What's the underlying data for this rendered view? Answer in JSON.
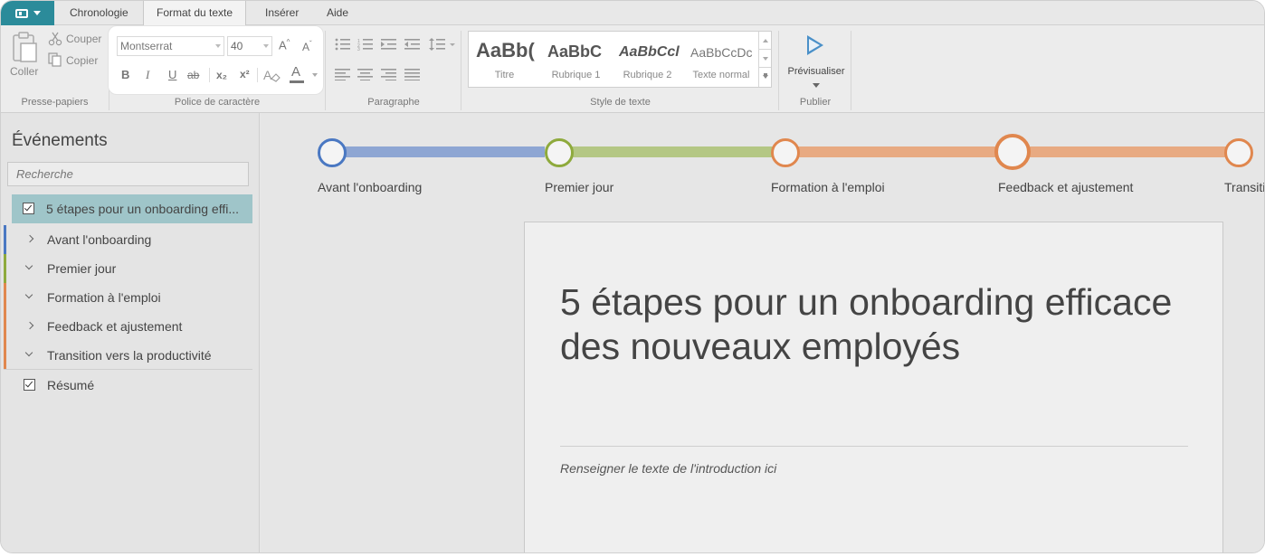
{
  "menu": {
    "tabs": [
      {
        "label": "Chronologie"
      },
      {
        "label": "Format du texte"
      },
      {
        "label": "Insérer"
      },
      {
        "label": "Aide"
      }
    ],
    "active_tab": "Format du texte"
  },
  "ribbon": {
    "clipboard": {
      "paste_label": "Coller",
      "cut_label": "Couper",
      "copy_label": "Copier",
      "group_label": "Presse-papiers"
    },
    "font": {
      "font_name": "Montserrat",
      "font_size": "40",
      "group_label": "Police de caractère",
      "bold": "B",
      "italic": "I",
      "underline": "U",
      "strike": "ab",
      "subscript": "x₂",
      "superscript": "x²",
      "font_color": "A",
      "grow": "A",
      "shrink": "A"
    },
    "paragraph": {
      "group_label": "Paragraphe"
    },
    "styles": {
      "group_label": "Style de texte",
      "items": [
        {
          "sample": "AaBb(",
          "name": "Titre"
        },
        {
          "sample": "AaBbC",
          "name": "Rubrique 1"
        },
        {
          "sample": "AaBbCcl",
          "name": "Rubrique 2"
        },
        {
          "sample": "AaBbCcDc",
          "name": "Texte normal"
        }
      ]
    },
    "publish": {
      "preview_label": "Prévisualiser",
      "group_label": "Publier"
    }
  },
  "sidebar": {
    "title": "Événements",
    "search_placeholder": "Recherche",
    "root_item": "5 étapes pour un onboarding effi...",
    "events": [
      {
        "label": "Avant l'onboarding",
        "expanded": false,
        "color": "#4a78c2"
      },
      {
        "label": "Premier jour",
        "expanded": true,
        "color": "#8eaa3c"
      },
      {
        "label": "Formation à l'emploi",
        "expanded": true,
        "color": "#e0874e"
      },
      {
        "label": "Feedback et ajustement",
        "expanded": false,
        "color": "#e0874e"
      },
      {
        "label": "Transition vers la productivité",
        "expanded": true,
        "color": "#e0874e"
      }
    ],
    "summary_item": "Résumé"
  },
  "timeline": {
    "labels": [
      "Avant l'onboarding",
      "Premier jour",
      "Formation à l'emploi",
      "Feedback et ajustement",
      "Transiti"
    ],
    "colors": {
      "blue": "#4a78c2",
      "green": "#8eaa3c",
      "orange": "#e0874e"
    }
  },
  "document": {
    "title": "5 étapes pour un onboarding efficace des nouveaux employés",
    "intro": "Renseigner le texte de l'introduction ici"
  },
  "icons": [
    "app-menu-icon",
    "paste-icon",
    "cut-icon",
    "copy-icon",
    "bullet-list-icon",
    "numbered-list-icon",
    "indent-icon",
    "outdent-icon",
    "line-spacing-icon",
    "align-icons",
    "play-icon",
    "chevron-icons",
    "checkbox-icons"
  ]
}
